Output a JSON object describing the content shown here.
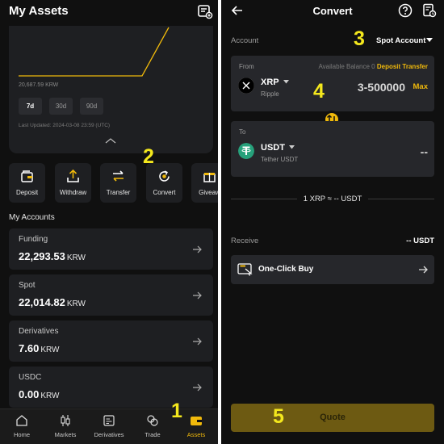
{
  "left": {
    "title": "My Assets",
    "chart": {
      "value_label": "20,687.59 KRW",
      "ranges": [
        "7d",
        "30d",
        "90d"
      ],
      "selected_range": "7d",
      "last_updated": "Last Updated: 2024-03-08 23:59 (UTC)",
      "line_color": "#f0b90b"
    },
    "actions": [
      {
        "label": "Deposit",
        "icon": "deposit-icon"
      },
      {
        "label": "Withdraw",
        "icon": "withdraw-icon"
      },
      {
        "label": "Transfer",
        "icon": "transfer-icon"
      },
      {
        "label": "Convert",
        "icon": "convert-icon"
      },
      {
        "label": "Giveaw",
        "icon": "gift-icon"
      }
    ],
    "accounts_title": "My Accounts",
    "accounts": [
      {
        "name": "Funding",
        "value": "22,293.53",
        "currency": "KRW"
      },
      {
        "name": "Spot",
        "value": "22,014.82",
        "currency": "KRW"
      },
      {
        "name": "Derivatives",
        "value": "7.60",
        "currency": "KRW"
      },
      {
        "name": "USDC",
        "value": "0.00",
        "currency": "KRW"
      }
    ],
    "nav": [
      {
        "label": "Home",
        "icon": "home-icon",
        "active": false
      },
      {
        "label": "Markets",
        "icon": "candlestick-icon",
        "active": false
      },
      {
        "label": "Derivatives",
        "icon": "derivatives-icon",
        "active": false
      },
      {
        "label": "Trade",
        "icon": "trade-icon",
        "active": false
      },
      {
        "label": "Assets",
        "icon": "wallet-icon",
        "active": true
      }
    ],
    "markers": [
      "1",
      "2"
    ]
  },
  "right": {
    "title": "Convert",
    "account_label": "Account",
    "account_select": "Spot Account",
    "from": {
      "label": "From",
      "balance_label": "Available Balance",
      "balance_value": "0",
      "deposit_link": "Deposit",
      "transfer_link": "Transfer",
      "coin": "XRP",
      "coin_name": "Ripple",
      "amount": "3-500000",
      "max_label": "Max"
    },
    "to": {
      "label": "To",
      "coin": "USDT",
      "coin_name": "Tether USDT",
      "amount": "--"
    },
    "rate": "1 XRP ≈ -- USDT",
    "receive_label": "Receive",
    "receive_value": "-- USDT",
    "one_click_label": "One-Click Buy",
    "quote_label": "Quote",
    "markers": [
      "3",
      "4",
      "5"
    ],
    "accent_color": "#f0b90b"
  }
}
